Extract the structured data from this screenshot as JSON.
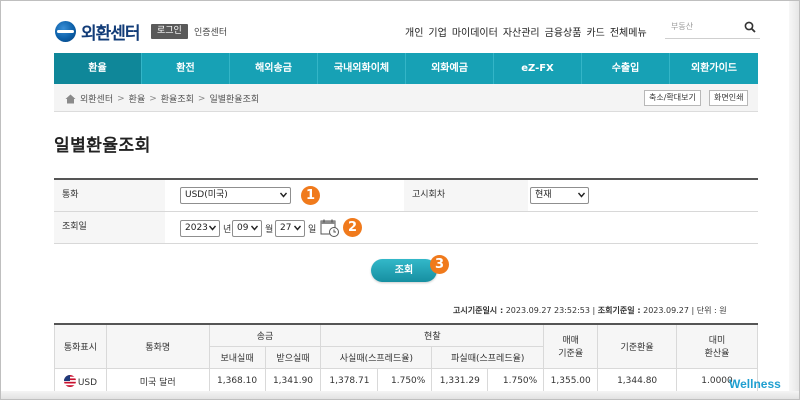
{
  "header": {
    "logo_text": "외환센터",
    "login_label": "로그인",
    "cert_label": "인증센터",
    "top_menu": [
      "개인",
      "기업",
      "마이데이터",
      "자산관리",
      "금융상품",
      "카드",
      "전체메뉴"
    ],
    "search_placeholder": "부동산"
  },
  "gnb": {
    "items": [
      "환율",
      "환전",
      "해외송금",
      "국내외화이체",
      "외화예금",
      "eZ-FX",
      "수출입",
      "외환가이드"
    ],
    "active": "환율"
  },
  "breadcrumb": {
    "items": [
      "외환센터",
      "환율",
      "환율조회",
      "일별환율조회"
    ],
    "zoom_label": "축소/확대보기",
    "print_label": "화면인쇄"
  },
  "page_title": "일별환율조회",
  "form": {
    "currency_label": "통화",
    "currency_value": "USD(미국)",
    "notice_label": "고시회차",
    "notice_value": "현재",
    "date_label": "조회일",
    "year": "2023",
    "year_unit": "년",
    "month": "09",
    "month_unit": "월",
    "day": "27",
    "day_unit": "일"
  },
  "badges": [
    "1",
    "2",
    "3"
  ],
  "search_button": "조회",
  "info": {
    "notice_time_label": "고시기준일시 :",
    "notice_time": "2023.09.27 23:52:53",
    "query_date_label": "조회기준일 :",
    "query_date": "2023.09.27",
    "unit_label": "단위 : 원"
  },
  "table": {
    "h_code": "통화표시",
    "h_name": "통화명",
    "h_remit": "송금",
    "h_send": "보내실때",
    "h_receive": "받으실때",
    "h_cash": "현찰",
    "h_buy_cash": "사실때(스프레드율)",
    "h_sell_cash": "파실때(스프레드율)",
    "h_trade_line1": "매매",
    "h_trade_line2": "기준율",
    "h_base": "기준환율",
    "h_usd_line1": "대미",
    "h_usd_line2": "환산율",
    "rows": [
      {
        "code": "USD",
        "name": "미국 달러",
        "send": "1,368.10",
        "receive": "1,341.90",
        "cash_buy": "1,378.71",
        "cash_buy_spread": "1.750%",
        "cash_sell": "1,331.29",
        "cash_sell_spread": "1.750%",
        "trade_base": "1,355.00",
        "base": "1,344.80",
        "usd_rate": "1.0000"
      }
    ]
  },
  "watermark": "Wellness",
  "colors": {
    "nav": "#17a1b5",
    "nav_active": "#0f8799",
    "badge": "#f07a1c",
    "button": "#168fa1",
    "brand": "#123c78"
  }
}
